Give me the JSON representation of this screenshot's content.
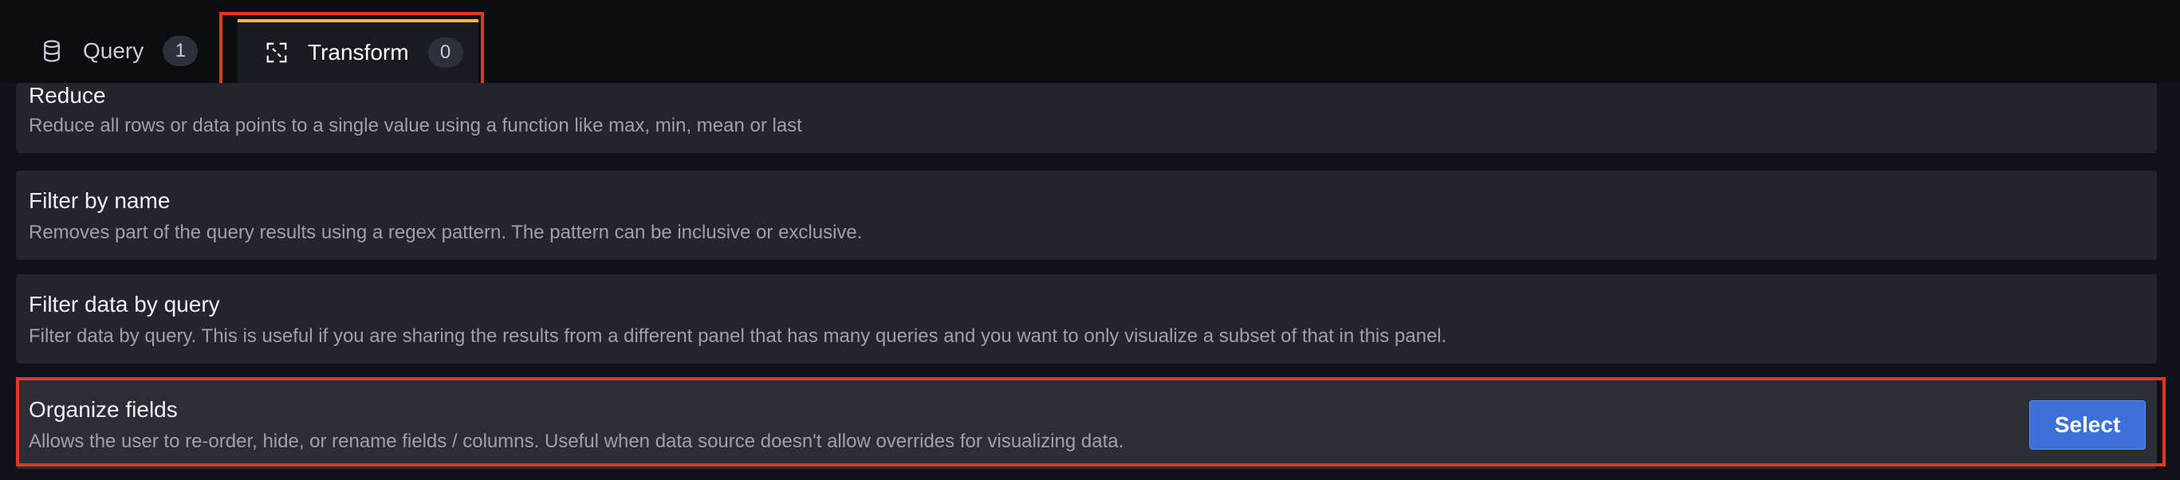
{
  "tabs": [
    {
      "label": "Query",
      "count": "1",
      "icon": "database-icon"
    },
    {
      "label": "Transform",
      "count": "0",
      "icon": "transform-icon"
    }
  ],
  "transformations": [
    {
      "title": "Reduce",
      "description": "Reduce all rows or data points to a single value using a function like max, min, mean or last"
    },
    {
      "title": "Filter by name",
      "description": "Removes part of the query results using a regex pattern. The pattern can be inclusive or exclusive."
    },
    {
      "title": "Filter data by query",
      "description": "Filter data by query. This is useful if you are sharing the results from a different panel that has many queries and you want to only visualize a subset of that in this panel."
    },
    {
      "title": "Organize fields",
      "description": "Allows the user to re-order, hide, or rename fields / columns. Useful when data source doesn't allow overrides for visualizing data.",
      "action_label": "Select"
    }
  ],
  "colors": {
    "accent_tab": "#f5b73d",
    "highlight": "#e0391d",
    "primary_button": "#3d71d9"
  }
}
